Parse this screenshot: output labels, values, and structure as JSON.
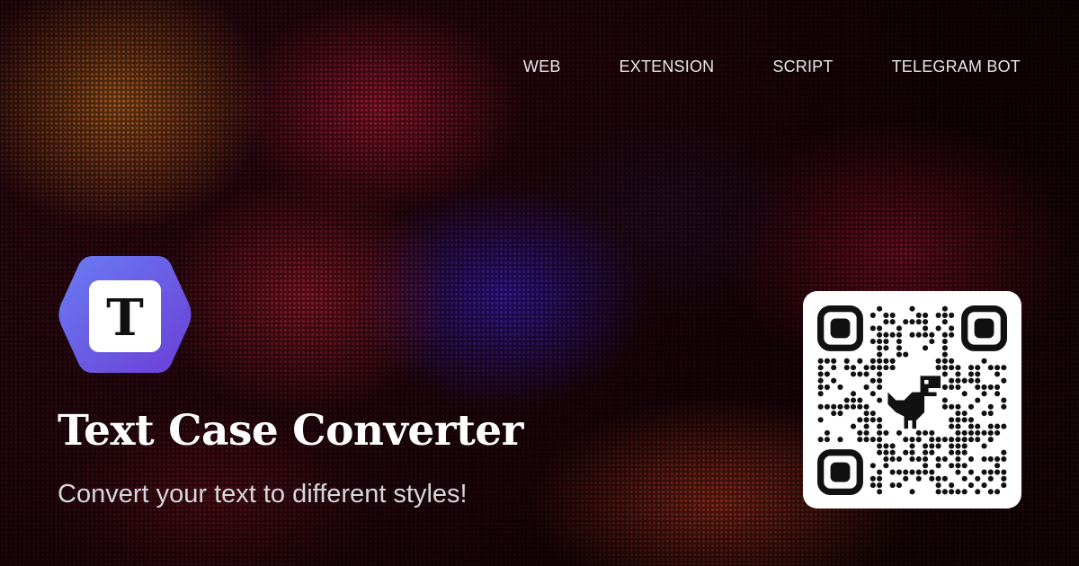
{
  "nav": {
    "items": [
      {
        "label": "WEB"
      },
      {
        "label": "EXTENSION"
      },
      {
        "label": "SCRIPT"
      },
      {
        "label": "TELEGRAM BOT"
      }
    ]
  },
  "logo": {
    "letter": "T",
    "gradient_start": "#6a7cf3",
    "gradient_end": "#6b3fd6",
    "tile_color": "#ffffff"
  },
  "hero": {
    "title": "Text Case Converter",
    "subtitle": "Convert your text to different styles!"
  },
  "qr": {
    "icon": "dinosaur-icon",
    "card_color": "#ffffff",
    "module_color": "#111111"
  }
}
